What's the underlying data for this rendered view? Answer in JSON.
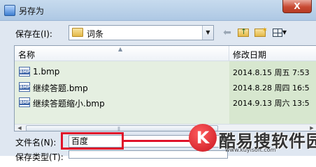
{
  "window": {
    "title": "另存为",
    "close_label": "X"
  },
  "toolbar": {
    "save_in_label": "保存在(I):",
    "current_folder": "词条",
    "dropdown_arrow": "▼",
    "back_glyph": "⬅"
  },
  "file_list": {
    "columns": {
      "name": "名称",
      "date_modified": "修改日期"
    },
    "files": [
      {
        "name": "1.bmp",
        "date": "2014.8.15 周五 7:53",
        "icon": "bmp-file-icon",
        "icon_label": "BMP"
      },
      {
        "name": "继续答题.bmp",
        "date": "2014.8.28 周四 16:5",
        "icon": "bmp-file-icon",
        "icon_label": "BMP"
      },
      {
        "name": "继续答题缩小.bmp",
        "date": "2014.9.13 周六 13:5",
        "icon": "bmp-file-icon",
        "icon_label": "BMP"
      }
    ]
  },
  "form": {
    "filename_label": "文件名(N):",
    "filename_value": "百度",
    "save_type_label": "保存类型(T):"
  },
  "watermark": {
    "logo_letter": "K",
    "text": "酷易搜软件园",
    "url": "www.kuyisoft.com"
  },
  "colors": {
    "highlight": "#e0122a",
    "row_selection": "#e5efe1",
    "title_bar": "#c7dbee"
  }
}
